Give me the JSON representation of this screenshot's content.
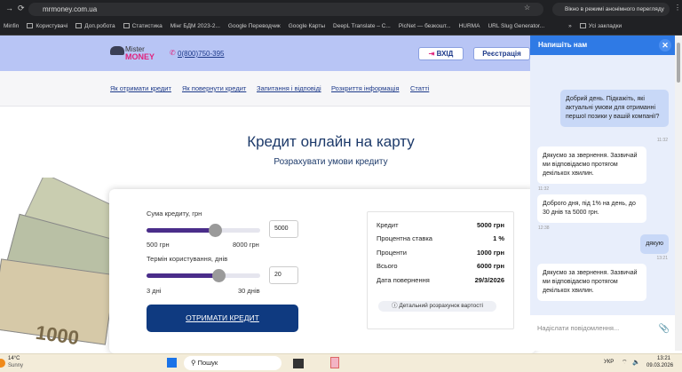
{
  "browser": {
    "url": "mrmoney.com.ua",
    "incognito": "Вікно в режимі анонімного перегляду",
    "bookmarks": [
      "Minfin",
      "Користувачі",
      "Доп.робота",
      "Статистика",
      "Мінг БДМ 2023-2...",
      "Google Переводчик",
      "Google Карты",
      "DeepL Translate – C...",
      "PicNet — безкошт...",
      "HURMA",
      "URL Slug Generator..."
    ],
    "all_bookmarks": "Усі закладки"
  },
  "site": {
    "logo_top": "Mister",
    "logo_bottom": "MONEY",
    "phone": "0(800)750-395",
    "login": "ВХІД",
    "register": "Реєстрація",
    "nav": [
      "Як отримати кредит",
      "Як повернути кредит",
      "Запитання і відповіді",
      "Розкриття інформація",
      "Статті"
    ],
    "title": "Кредит онлайн на карту",
    "subtitle": "Розрахувати умови кредиту"
  },
  "calc": {
    "amount_label": "Сума кредиту, грн",
    "amount_value": "5000",
    "amount_min": "500 грн",
    "amount_max": "8000 грн",
    "amount_fraction": 0.6,
    "term_label": "Термін користування, днів",
    "term_value": "20",
    "term_min": "3 дні",
    "term_max": "30 днів",
    "term_fraction": 0.63,
    "cta": "ОТРИМАТИ КРЕДИТ",
    "summary": [
      {
        "k": "Кредит",
        "v": "5000 грн"
      },
      {
        "k": "Процентна ставка",
        "v": "1 %"
      },
      {
        "k": "Проценти",
        "v": "1000 грн"
      },
      {
        "k": "Всього",
        "v": "6000 грн"
      },
      {
        "k": "Дата повернення",
        "v": "29/3/2026"
      }
    ],
    "detail": "ⓘ Детальний розрахунок вартості"
  },
  "chat": {
    "title": "Напишіть нам",
    "messages": [
      {
        "text": "Добрий день. Підкажіть, які актуальні умови для отриманні першої позики у вашій компанії?",
        "time": "11:32"
      },
      {
        "text": "Дякуємо за звернення. Зазвичай ми відповідаємо протягом декількох хвилин.",
        "time": "11:32"
      },
      {
        "text": "Доброго дня, під 1% на день, до 30 днів та 5000 грн.",
        "time": "12:38"
      },
      {
        "text": "дякую",
        "time": "13:21"
      },
      {
        "text": "Дякуємо за звернення. Зазвичай ми відповідаємо протягом декількох хвилин.",
        "time": ""
      }
    ],
    "placeholder": "Надіслати повідомлення..."
  },
  "taskbar": {
    "temp": "14°C",
    "weather": "Sunny",
    "search": "Пошук",
    "lang": "УКР",
    "time": "13:21",
    "date": "09.03.2026"
  }
}
